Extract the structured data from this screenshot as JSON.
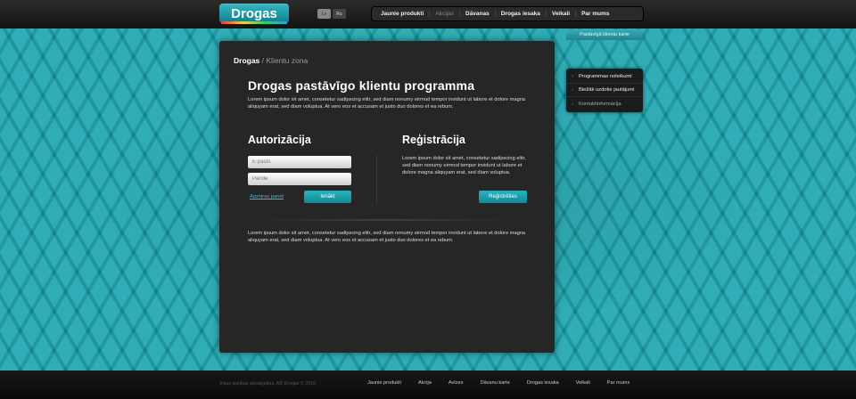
{
  "header": {
    "logo": "Drogas",
    "languages": [
      "Lv",
      "Ru"
    ],
    "nav": [
      "Jaunie produkti",
      "Akcijas",
      "Dāvanas",
      "Drogas iesaka",
      "Veikali",
      "Par mums"
    ],
    "card_tab": "Pastāvīgā klienta karte"
  },
  "breadcrumb": {
    "root": "Drogas",
    "separator": " / ",
    "current": "Klientu zona"
  },
  "main": {
    "title": "Drogas pastāvīgo klientu programma",
    "intro": "Lorem ipsum dolor sit amet, consetetur sadipscing elitr, sed diam nonumy eirmod tempor invidunt ut labore et dolore magna aliquyam erat, sed diam voluptua. At vero eos et accusam et justo duo dolores et ea rebum.",
    "auth": {
      "title": "Autorizācija",
      "email_placeholder": "E-pasts",
      "password_placeholder": "Parole",
      "forgot_link": "Aizmirsu paroli",
      "login_button": "Ienākt"
    },
    "register": {
      "title": "Reģistrācija",
      "text": "Lorem ipsum dolor sit amet, consetetur sadipscing elitr, sed diam nonumy eirmod tempor invidunt ut labore et dolore magna aliquyam erat, sed diam voluptua.",
      "button": "Reģistrēties"
    },
    "outro": "Lorem ipsum dolor sit amet, consetetur sadipscing elitr, sed diam nonumy eirmod tempor invidunt ut labore et dolore magna aliquyam erat, sed diam voluptua. At vero eos et accusam et justo duo dolores et ea rebum."
  },
  "sidebar": [
    "Programmas noteikumi",
    "Biežāk uzdotie jautājumi",
    "Kontaktinformācija"
  ],
  "footer": {
    "copyright": "Visas tiesības aizsargātas. AB Drogas © 2010",
    "links": [
      "Jaunie produkti",
      "Akcija",
      "Avīzes",
      "Dāvanu karte",
      "Drogas iesaka",
      "Veikali",
      "Par mums"
    ]
  },
  "colors": {
    "accent": "#17a3ad",
    "panel": "#262626",
    "button": "#1a9ea9"
  }
}
